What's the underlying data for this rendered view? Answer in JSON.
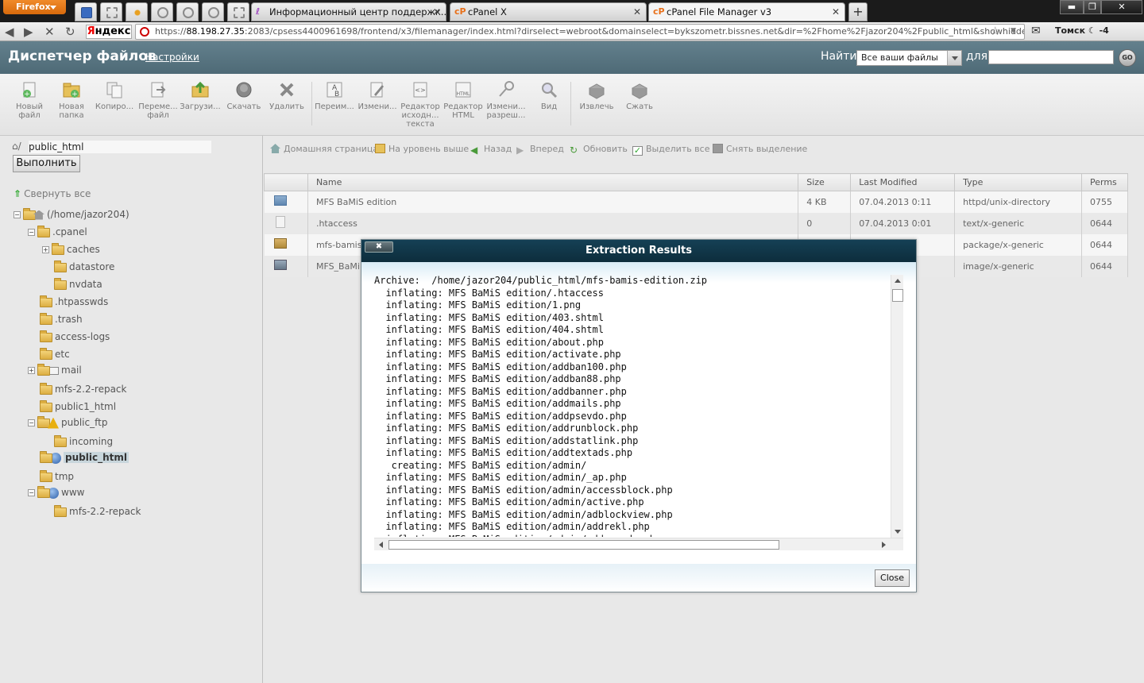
{
  "browser": {
    "menu_label": "Firefox",
    "tabs": [
      {
        "label": "Информационный центр поддержк...",
        "active": false
      },
      {
        "label": "cPanel X",
        "active": false
      },
      {
        "label": "cPanel File Manager v3",
        "active": true
      }
    ],
    "tab_favicon": "cP",
    "new_tab": "+",
    "yandex_y": "Я",
    "yandex_rest": "ндекс",
    "url_prefix": "https://",
    "url_host": "88.198.27.35",
    "url_rest": ":2083/cpsess4400961698/frontend/x3/filemanager/index.html?dirselect=webroot&domainselect=bykszometr.bissnes.net&dir=%2Fhome%2Fjazor204%2Fpublic_html&showhidden=1",
    "weather_city": "Томск",
    "weather_temp": "-4"
  },
  "header": {
    "title": "Диспетчер файлов",
    "settings_link": "Настройки",
    "find_label": "Найти",
    "find_scope": "Все ваши файлы",
    "for_label": "для",
    "go_label": "GO"
  },
  "toolbar": {
    "new_file": [
      "Новый",
      "файл"
    ],
    "new_folder": [
      "Новая",
      "папка"
    ],
    "copy": [
      "Копиро..."
    ],
    "move": [
      "Переме...",
      "файл"
    ],
    "upload": [
      "Загрузи..."
    ],
    "download": [
      "Скачать"
    ],
    "delete": [
      "Удалить"
    ],
    "rename": [
      "Переим..."
    ],
    "edit": [
      "Измени..."
    ],
    "code_editor": [
      "Редактор",
      "исходн...",
      "текста"
    ],
    "html_editor": [
      "Редактор",
      "HTML"
    ],
    "permissions": [
      "Измени...",
      "разреш..."
    ],
    "view": [
      "Вид"
    ],
    "extract": [
      "Извлечь"
    ],
    "compress": [
      "Сжать"
    ]
  },
  "left": {
    "path_value": "public_html",
    "go_label": "Выполнить",
    "collapse_all": "Свернуть все",
    "tree": [
      {
        "label": "(/home/jazor204)"
      },
      {
        "label": ".cpanel"
      },
      {
        "label": "caches"
      },
      {
        "label": "datastore"
      },
      {
        "label": "nvdata"
      },
      {
        "label": ".htpasswds"
      },
      {
        "label": ".trash"
      },
      {
        "label": "access-logs"
      },
      {
        "label": "etc"
      },
      {
        "label": "mail"
      },
      {
        "label": "mfs-2.2-repack"
      },
      {
        "label": "public1_html"
      },
      {
        "label": "public_ftp"
      },
      {
        "label": "incoming"
      },
      {
        "label": "public_html",
        "selected": true
      },
      {
        "label": "tmp"
      },
      {
        "label": "www"
      },
      {
        "label": "mfs-2.2-repack"
      }
    ]
  },
  "nav": {
    "home": "Домашняя страница",
    "up": "На уровень выше",
    "back": "Назад",
    "forward": "Вперед",
    "refresh": "Обновить",
    "select_all": "Выделить все",
    "deselect": "Снять выделение"
  },
  "files": {
    "columns": [
      "Name",
      "Size",
      "Last Modified",
      "Type",
      "Perms"
    ],
    "rows": [
      {
        "name": "MFS BaMiS edition",
        "size": "4 KB",
        "modified": "07.04.2013 0:11",
        "type": "httpd/unix-directory",
        "perms": "0755",
        "icon": "folder-icon"
      },
      {
        "name": ".htaccess",
        "size": "0",
        "modified": "07.04.2013 0:01",
        "type": "text/x-generic",
        "perms": "0644",
        "icon": "text-file-icon"
      },
      {
        "name": "mfs-bamis-e",
        "size": "",
        "modified": "",
        "type": "package/x-generic",
        "perms": "0644",
        "icon": "package-icon"
      },
      {
        "name": "MFS_BaMi",
        "size": "",
        "modified": "",
        "type": "image/x-generic",
        "perms": "0644",
        "icon": "image-file-icon"
      }
    ]
  },
  "dialog": {
    "title": "Extraction Results",
    "close_x": "✖",
    "close_label": "Close",
    "log_lines": [
      "Archive:  /home/jazor204/public_html/mfs-bamis-edition.zip",
      "  inflating: MFS BaMiS edition/.htaccess",
      "  inflating: MFS BaMiS edition/1.png",
      "  inflating: MFS BaMiS edition/403.shtml",
      "  inflating: MFS BaMiS edition/404.shtml",
      "  inflating: MFS BaMiS edition/about.php",
      "  inflating: MFS BaMiS edition/activate.php",
      "  inflating: MFS BaMiS edition/addban100.php",
      "  inflating: MFS BaMiS edition/addban88.php",
      "  inflating: MFS BaMiS edition/addbanner.php",
      "  inflating: MFS BaMiS edition/addmails.php",
      "  inflating: MFS BaMiS edition/addpsevdo.php",
      "  inflating: MFS BaMiS edition/addrunblock.php",
      "  inflating: MFS BaMiS edition/addstatlink.php",
      "  inflating: MFS BaMiS edition/addtextads.php",
      "   creating: MFS BaMiS edition/admin/",
      "  inflating: MFS BaMiS edition/admin/_ap.php",
      "  inflating: MFS BaMiS edition/admin/accessblock.php",
      "  inflating: MFS BaMiS edition/admin/active.php",
      "  inflating: MFS BaMiS edition/admin/adblockview.php",
      "  inflating: MFS BaMiS edition/admin/addrekl.php",
      "  inflating: MFS BaMiS edition/admin/addrunads.php"
    ]
  },
  "colors": {
    "header_bg": "#587480",
    "dialog_title_bg": "#133a4d",
    "firefox_orange": "#e67a18"
  }
}
